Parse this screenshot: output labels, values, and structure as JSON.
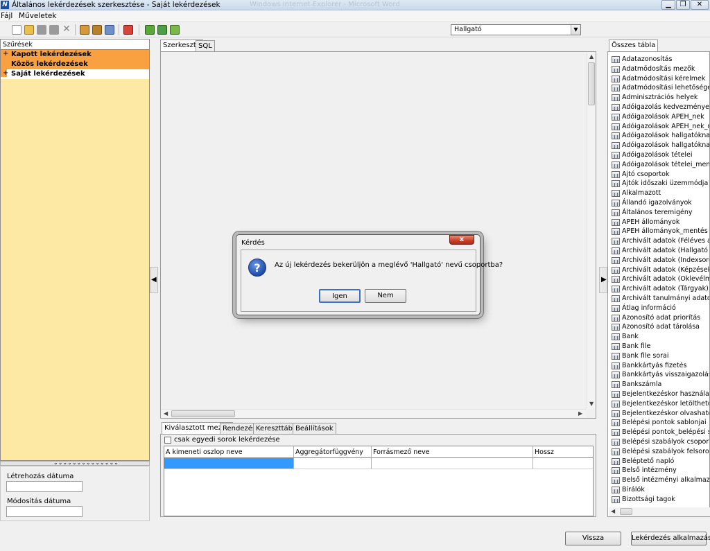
{
  "window": {
    "title": "Általános lekérdezések szerkesztése - Saját lekérdezések",
    "app_icon": "N",
    "background_title": "Windows Internet Explorer - Microsoft Word"
  },
  "menu": {
    "items": [
      "Fájl",
      "Műveletek"
    ]
  },
  "toolbar": {
    "group_combo_value": "Hallgató",
    "combo_arrow": "▼"
  },
  "left": {
    "filter_header": "Szűrések",
    "tree": [
      {
        "expander": "+",
        "label": "Kapott lekérdezések",
        "selected": true
      },
      {
        "expander": "",
        "label": "Közös lekérdezések",
        "selected": true
      },
      {
        "expander": "+",
        "label": "Saját lekérdezések",
        "selected": false
      }
    ],
    "splitter_glyph": "⌄⌄⌄⌄⌄⌄⌄⌄⌄⌄⌄⌄⌄⌄",
    "created_label": "Létrehozás dátuma",
    "created_value": "",
    "modified_label": "Módosítás dátuma",
    "modified_value": ""
  },
  "editor": {
    "tabs": [
      "Szerkesztő",
      "SQL"
    ],
    "bottom_tabs": [
      "Kiválasztott mezők",
      "Rendezés",
      "Kereszttábla",
      "Beállítások"
    ],
    "checkbox_label": "csak egyedi sorok lekérdezése",
    "checkbox_checked": false,
    "columns": [
      "A kimeneti oszlop neve",
      "Aggregátorfüggvény",
      "Forrásmező neve",
      "Hossz"
    ]
  },
  "right": {
    "tab": "Összes tábla",
    "tables": [
      "Adatazonosítás",
      "Adatmódosítás mezők",
      "Adatmódosítási kérelmek",
      "Adatmódosítási lehetőségek",
      "Adminisztrációs helyek",
      "Adóigazolás kedvezményezettje",
      "Adóigazolások APEH_nek",
      "Adóigazolások APEH_nek_mentés",
      "Adóigazolások hallgatóknak",
      "Adóigazolások hallgatóknak_mentés",
      "Adóigazolások tételei",
      "Adóigazolások tételei_mentés",
      "Ajtó csoportok",
      "Ajtók időszaki üzemmódja",
      "Alkalmazott",
      "Állandó igazolványok",
      "Általános teremigény",
      "APEH állományok",
      "APEH állományok_mentés",
      "Archivált adatok (Féléves adatok)",
      "Archivált adatok (Hallgató tanulmányai)",
      "Archivált adatok (Indexsorok)",
      "Archivált adatok (Képzések)",
      "Archivált adatok (Oklevélmellékletek)",
      "Archivált adatok (Tárgyak)",
      "Archivált tanulmányi adatok (Képzések)",
      "Átlag információ",
      "Azonosító adat priorítás",
      "Azonosító adat tárolása",
      "Bank",
      "Bank file",
      "Bank file sorai",
      "Bankkártyás fizetés",
      "Bankkártyás visszaigazolás",
      "Bankszámla",
      "Bejelentkezéskor használatos linkek",
      "Bejelentkezéskor letölthető dokumentumok",
      "Bejelentkezéskor olvasható hírek",
      "Belépési pontok sablonjai",
      "Belépési pontok_belépési szabályok",
      "Belépési szabályok csoportosítása",
      "Belépési szabályok felsorolása",
      "Beléptető napló",
      "Belső intézmény",
      "Belső intézményi alkalmazott",
      "Bírálók",
      "Bizottsági tagok"
    ]
  },
  "buttons": {
    "back": "Vissza",
    "apply": "Lekérdezés alkalmazása"
  },
  "dialog": {
    "title": "Kérdés",
    "close": "x",
    "question_icon": "?",
    "message": "Az új lekérdezés bekerüljön a meglévő 'Hallgató' nevű csoportba?",
    "yes": "Igen",
    "no": "Nem"
  },
  "colors": {
    "tree_selected": "#f9a141",
    "panel_bg": "#fde9a3",
    "grid_selected": "#3399ff"
  }
}
